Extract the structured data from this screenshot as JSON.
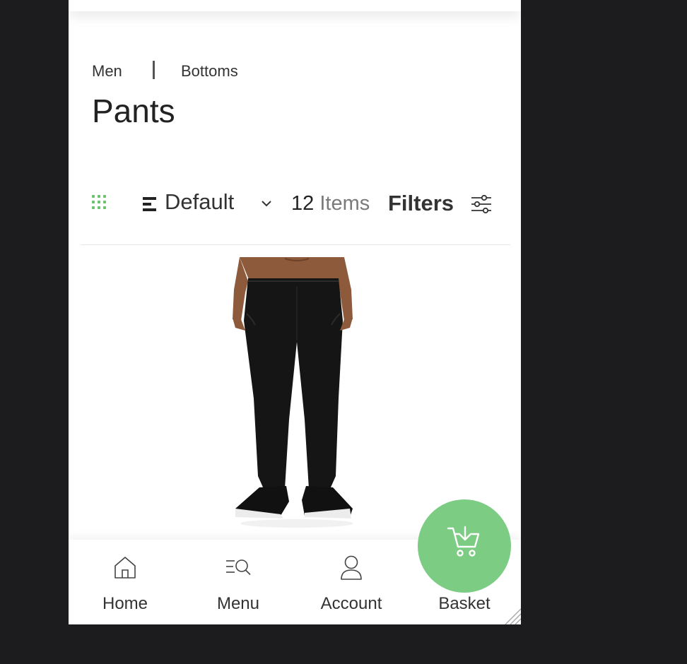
{
  "breadcrumb": {
    "first": "Men",
    "second": "Bottoms"
  },
  "page": {
    "title": "Pants"
  },
  "toolbar": {
    "sort_value": "Default",
    "items_count": "12",
    "items_label": "Items",
    "filters_label": "Filters"
  },
  "nav": {
    "home": "Home",
    "menu": "Menu",
    "account": "Account",
    "basket": "Basket"
  },
  "icons": {
    "grid": "grid-icon",
    "sort": "sort-icon",
    "chevron": "chevron-down-icon",
    "filters": "sliders-icon",
    "home": "home-icon",
    "menu": "search-menu-icon",
    "account": "user-icon",
    "basket": "cart-icon"
  },
  "colors": {
    "accent": "#7ccc83",
    "grid_icon": "#6cc36a",
    "background": "#1c1c1e"
  }
}
